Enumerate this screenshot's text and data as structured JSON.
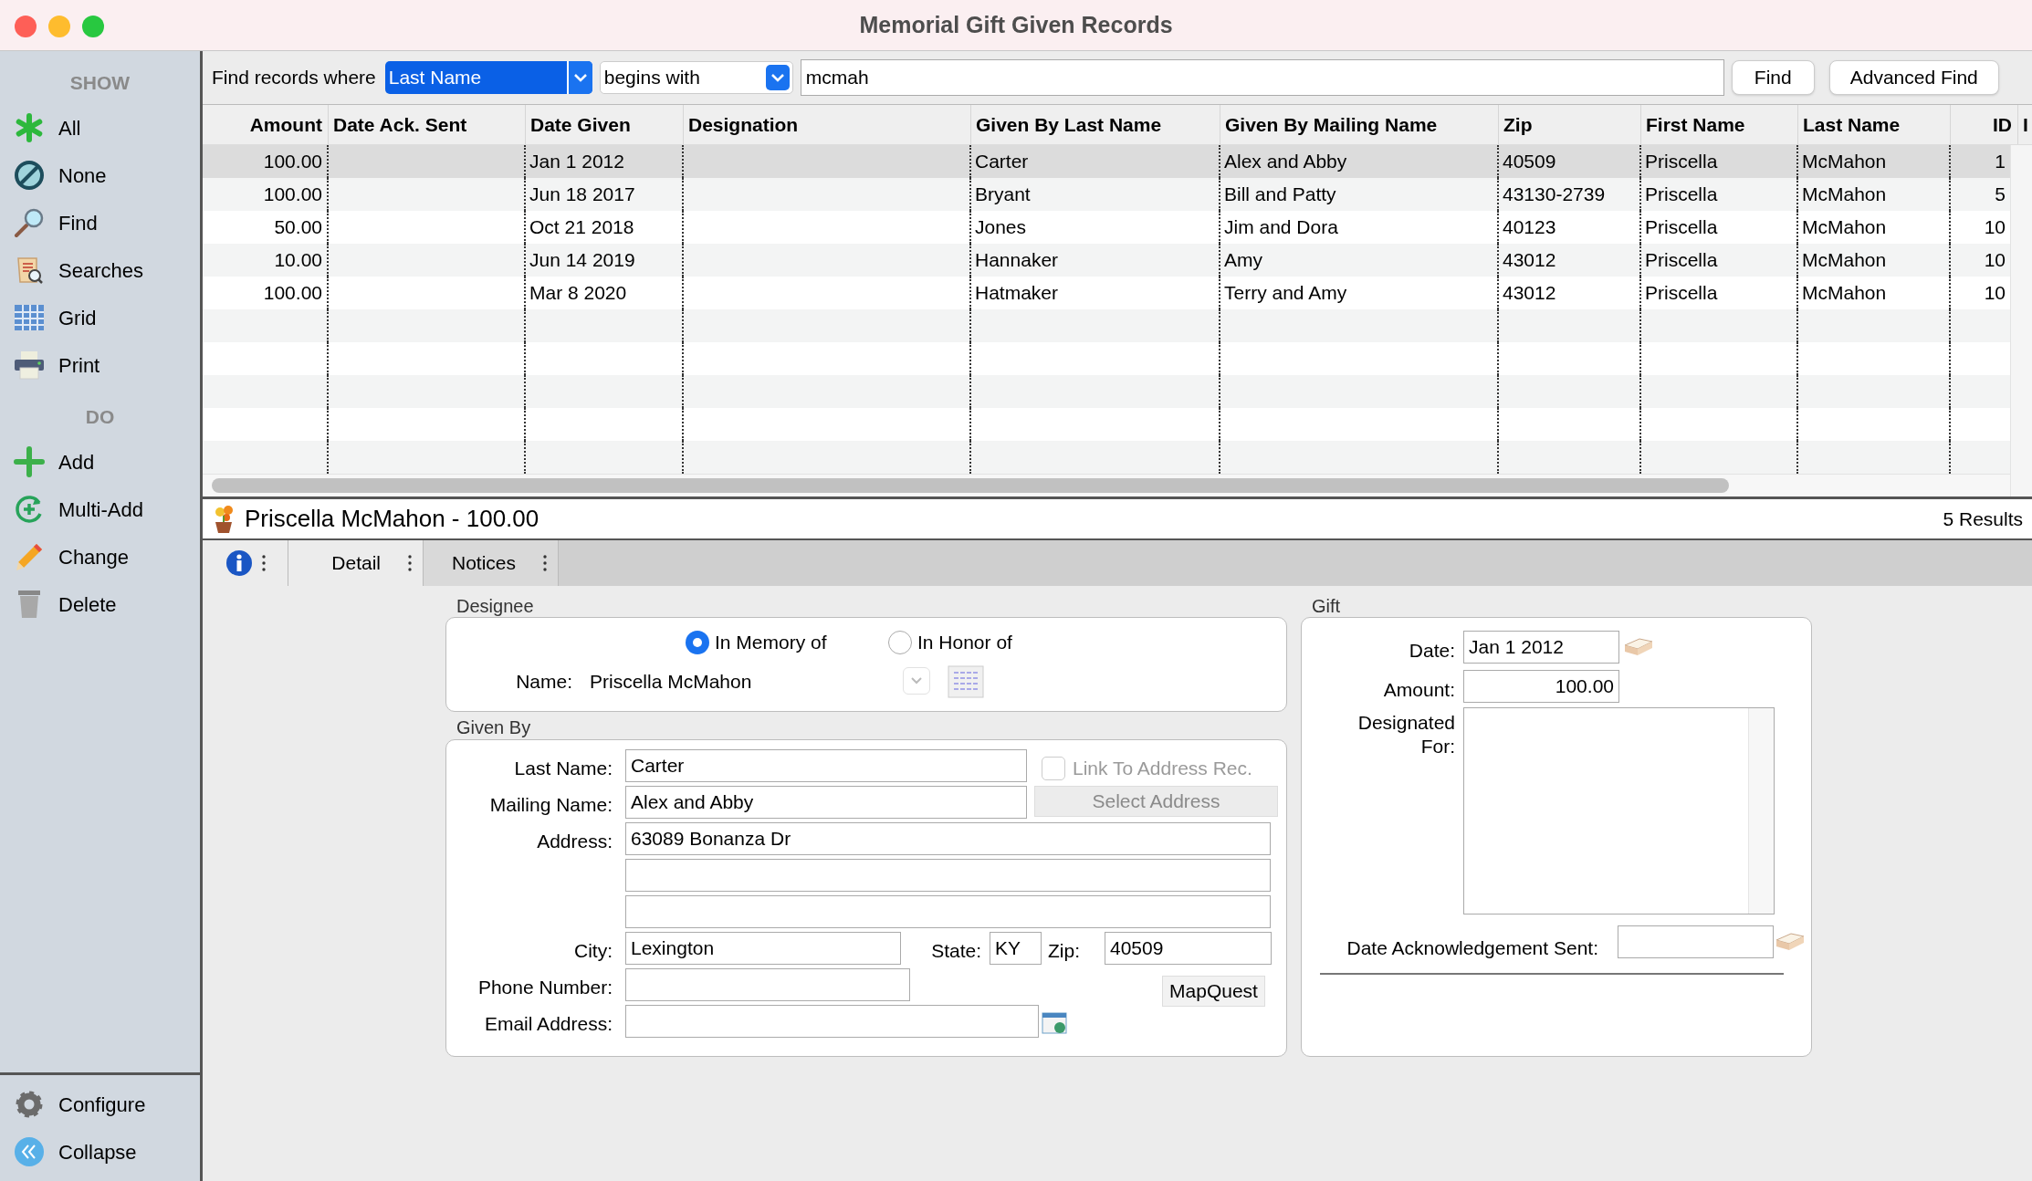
{
  "window": {
    "title": "Memorial Gift Given Records"
  },
  "sidebar": {
    "sections": [
      {
        "heading": "SHOW",
        "items": [
          {
            "label": "All"
          },
          {
            "label": "None"
          },
          {
            "label": "Find"
          },
          {
            "label": "Searches"
          },
          {
            "label": "Grid"
          },
          {
            "label": "Print"
          }
        ]
      },
      {
        "heading": "DO",
        "items": [
          {
            "label": "Add"
          },
          {
            "label": "Multi-Add"
          },
          {
            "label": "Change"
          },
          {
            "label": "Delete"
          }
        ]
      }
    ],
    "footer": [
      {
        "label": "Configure"
      },
      {
        "label": "Collapse"
      }
    ]
  },
  "search": {
    "label": "Find records where",
    "field": "Last Name",
    "operator": "begins with",
    "value": "mcmah",
    "buttons": [
      "Find",
      "Advanced Find"
    ]
  },
  "table": {
    "columns": [
      "Amount",
      "Date Ack. Sent",
      "Date Given",
      "Designation",
      "Given By Last Name",
      "Given By Mailing Name",
      "Zip",
      "First Name",
      "Last Name",
      "ID",
      "I"
    ],
    "rows": [
      {
        "selected": true,
        "cells": [
          "100.00",
          "",
          "Jan 1 2012",
          "",
          "Carter",
          "Alex and Abby",
          "40509",
          "Priscella",
          "McMahon",
          "1"
        ]
      },
      {
        "selected": false,
        "cells": [
          "100.00",
          "",
          "Jun 18 2017",
          "",
          "Bryant",
          "Bill and Patty",
          "43130-2739",
          "Priscella",
          "McMahon",
          "5"
        ]
      },
      {
        "selected": false,
        "cells": [
          "50.00",
          "",
          "Oct 21 2018",
          "",
          "Jones",
          "Jim and Dora",
          "40123",
          "Priscella",
          "McMahon",
          "10"
        ]
      },
      {
        "selected": false,
        "cells": [
          "10.00",
          "",
          "Jun 14 2019",
          "",
          "Hannaker",
          "Amy",
          "43012",
          "Priscella",
          "McMahon",
          "10"
        ]
      },
      {
        "selected": false,
        "cells": [
          "100.00",
          "",
          "Mar 8 2020",
          "",
          "Hatmaker",
          "Terry and Amy",
          "43012",
          "Priscella",
          "McMahon",
          "10"
        ]
      }
    ]
  },
  "record": {
    "title": "Priscella McMahon - 100.00",
    "results": "5 Results"
  },
  "tabs": [
    {
      "label": "Detail",
      "selected": true
    },
    {
      "label": "Notices",
      "selected": false
    }
  ],
  "designee": {
    "heading": "Designee",
    "options": [
      {
        "label": "In Memory of",
        "selected": true
      },
      {
        "label": "In Honor of",
        "selected": false
      }
    ],
    "name_label": "Name:",
    "name": "Priscella McMahon"
  },
  "given_by": {
    "heading": "Given By",
    "last_name": {
      "label": "Last Name:",
      "value": "Carter"
    },
    "link": {
      "label": "Link To Address Rec.",
      "checked": false,
      "disabled": true
    },
    "select_address": {
      "label": "Select Address",
      "disabled": true
    },
    "mailing_name": {
      "label": "Mailing Name:",
      "value": "Alex and Abby"
    },
    "address": {
      "label": "Address:",
      "lines": [
        "63089 Bonanza Dr"
      ]
    },
    "city": {
      "label": "City:",
      "value": "Lexington"
    },
    "state": {
      "label": "State:",
      "value": "KY"
    },
    "zip": {
      "label": "Zip:",
      "value": "40509"
    },
    "phone": {
      "label": "Phone Number:"
    },
    "email": {
      "label": "Email Address:"
    },
    "mapquest": "MapQuest"
  },
  "gift": {
    "heading": "Gift",
    "date": {
      "label": "Date:",
      "value": "Jan 1 2012"
    },
    "amount": {
      "label": "Amount:",
      "value": "100.00"
    },
    "designated_for": {
      "label": "Designated For:"
    },
    "date_ack": {
      "label": "Date Acknowledgement Sent:"
    }
  }
}
